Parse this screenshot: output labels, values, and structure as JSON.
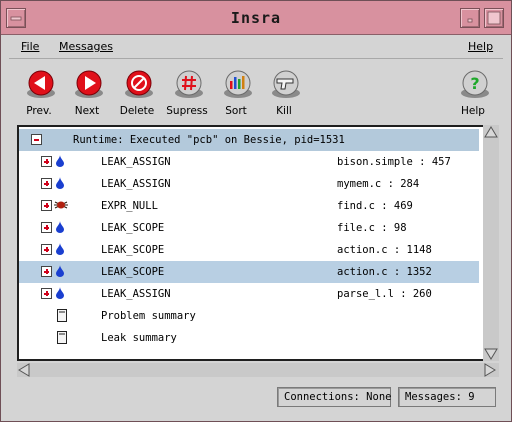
{
  "window": {
    "title": "Insra"
  },
  "menubar": {
    "file": "File",
    "messages": "Messages",
    "help": "Help"
  },
  "toolbar": {
    "buttons": [
      {
        "label": "Prev.",
        "icon": "prev-arrow-icon",
        "color": "#e0101a"
      },
      {
        "label": "Next",
        "icon": "next-arrow-icon",
        "color": "#e0101a"
      },
      {
        "label": "Delete",
        "icon": "no-entry-icon",
        "color": "#e0101a"
      },
      {
        "label": "Supress",
        "icon": "hash-icon",
        "color": "#e0101a"
      },
      {
        "label": "Sort",
        "icon": "bars-sort-icon",
        "color": "#2a2a2a"
      },
      {
        "label": "Kill",
        "icon": "gun-icon",
        "color": "#2a2a2a"
      },
      {
        "label": "Help",
        "icon": "question-icon",
        "color": "#1ea82a"
      }
    ]
  },
  "tree": {
    "header": "Runtime: Executed \"pcb\" on Bessie, pid=1531",
    "rows": [
      {
        "name": "LEAK_ASSIGN",
        "location": "bison.simple : 457",
        "kind": "leak"
      },
      {
        "name": "LEAK_ASSIGN",
        "location": "mymem.c : 284",
        "kind": "leak"
      },
      {
        "name": "EXPR_NULL",
        "location": "find.c : 469",
        "kind": "bug"
      },
      {
        "name": "LEAK_SCOPE",
        "location": "file.c : 98",
        "kind": "leak"
      },
      {
        "name": "LEAK_SCOPE",
        "location": "action.c : 1148",
        "kind": "leak"
      },
      {
        "name": "LEAK_SCOPE",
        "location": "action.c : 1352",
        "kind": "leak",
        "selected": true
      },
      {
        "name": "LEAK_ASSIGN",
        "location": "parse_l.l : 260",
        "kind": "leak"
      }
    ],
    "summaries": [
      {
        "label": "Problem summary"
      },
      {
        "label": "Leak summary"
      }
    ]
  },
  "status": {
    "connections": "Connections: None",
    "messages": "Messages: 9"
  },
  "colors": {
    "titlebar": "#d8919f",
    "header_row": "#b3c9db",
    "selected_row": "#b8cfe3",
    "leak_drop": "#1a3fd0"
  }
}
